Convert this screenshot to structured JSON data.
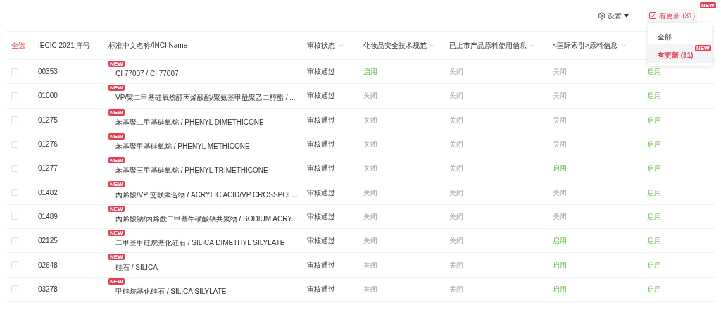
{
  "toolbar": {
    "settings": "设置",
    "update_filter": {
      "label": "有更新 (31)",
      "checked": true,
      "badge": "NEW"
    }
  },
  "dropdown": {
    "items": [
      {
        "label": "全部",
        "selected": false
      },
      {
        "label": "有更新 (31)",
        "selected": true,
        "badge": "NEW"
      }
    ]
  },
  "table": {
    "select_all": "全选",
    "columns": [
      {
        "label": "IECIC 2021 序号",
        "dropdown": false
      },
      {
        "label": "标准中文名称/INCI Name",
        "dropdown": false
      },
      {
        "label": "审核状态",
        "dropdown": true
      },
      {
        "label": "化妆品安全技术规范",
        "dropdown": true
      },
      {
        "label": "已上市产品原料使用信息",
        "dropdown": true
      },
      {
        "label": "<国际索引>原料信息",
        "dropdown": true
      }
    ],
    "rows": [
      {
        "checked": false,
        "id": "00353",
        "badge": "NEW",
        "name": "CI 77007 / CI 77007",
        "status": "审核通过",
        "flags": [
          {
            "text": "启用",
            "on": true
          },
          {
            "text": "关闭",
            "on": false
          },
          {
            "text": "关闭",
            "on": false
          },
          {
            "text": "启用",
            "on": true
          }
        ]
      },
      {
        "checked": false,
        "id": "01000",
        "badge": "NEW",
        "name": "VP/聚二甲基硅氧烷醇丙烯酸酯/聚氨基甲酰聚乙二醇酯 / ...",
        "status": "审核通过",
        "flags": [
          {
            "text": "关闭",
            "on": false
          },
          {
            "text": "关闭",
            "on": false
          },
          {
            "text": "关闭",
            "on": false
          },
          {
            "text": "启用",
            "on": true
          }
        ]
      },
      {
        "checked": false,
        "id": "01275",
        "badge": "NEW",
        "name": "苯基聚二甲基硅氧烷 / PHENYL DIMETHICONE",
        "status": "审核通过",
        "flags": [
          {
            "text": "关闭",
            "on": false
          },
          {
            "text": "关闭",
            "on": false
          },
          {
            "text": "关闭",
            "on": false
          },
          {
            "text": "启用",
            "on": true
          }
        ]
      },
      {
        "checked": false,
        "id": "01276",
        "badge": "NEW",
        "name": "苯基聚甲基硅氧烷 / PHENYL METHICONE",
        "status": "审核通过",
        "flags": [
          {
            "text": "关闭",
            "on": false
          },
          {
            "text": "关闭",
            "on": false
          },
          {
            "text": "关闭",
            "on": false
          },
          {
            "text": "启用",
            "on": true
          }
        ]
      },
      {
        "checked": false,
        "id": "01277",
        "badge": "NEW",
        "name": "苯基聚三甲基硅氧烷 / PHENYL TRIMETHICONE",
        "status": "审核通过",
        "flags": [
          {
            "text": "关闭",
            "on": false
          },
          {
            "text": "关闭",
            "on": false
          },
          {
            "text": "启用",
            "on": true
          },
          {
            "text": "启用",
            "on": true
          }
        ]
      },
      {
        "checked": false,
        "id": "01482",
        "badge": "NEW",
        "name": "丙烯酸/VP 交联聚合物 / ACRYLIC ACID/VP CROSSPOL...",
        "status": "审核通过",
        "flags": [
          {
            "text": "关闭",
            "on": false
          },
          {
            "text": "关闭",
            "on": false
          },
          {
            "text": "关闭",
            "on": false
          },
          {
            "text": "启用",
            "on": true
          }
        ]
      },
      {
        "checked": false,
        "id": "01489",
        "badge": "NEW",
        "name": "丙烯酸钠/丙烯酰二甲基牛磺酸钠共聚物 / SODIUM ACRY...",
        "status": "审核通过",
        "flags": [
          {
            "text": "关闭",
            "on": false
          },
          {
            "text": "关闭",
            "on": false
          },
          {
            "text": "关闭",
            "on": false
          },
          {
            "text": "启用",
            "on": true
          }
        ]
      },
      {
        "checked": false,
        "id": "02125",
        "badge": "NEW",
        "name": "二甲基甲硅烷基化硅石 / SILICA DIMETHYL SILYLATE",
        "status": "审核通过",
        "flags": [
          {
            "text": "关闭",
            "on": false
          },
          {
            "text": "关闭",
            "on": false
          },
          {
            "text": "启用",
            "on": true
          },
          {
            "text": "启用",
            "on": true
          }
        ]
      },
      {
        "checked": false,
        "id": "02648",
        "badge": "NEW",
        "name": "硅石 / SILICA",
        "status": "审核通过",
        "flags": [
          {
            "text": "关闭",
            "on": false
          },
          {
            "text": "关闭",
            "on": false
          },
          {
            "text": "启用",
            "on": true
          },
          {
            "text": "启用",
            "on": true
          }
        ]
      },
      {
        "checked": false,
        "id": "03278",
        "badge": "NEW",
        "name": "甲硅烷基化硅石 / SILICA SILYLATE",
        "status": "审核通过",
        "flags": [
          {
            "text": "关闭",
            "on": false
          },
          {
            "text": "关闭",
            "on": false
          },
          {
            "text": "启用",
            "on": true
          },
          {
            "text": "启用",
            "on": true
          }
        ]
      }
    ]
  }
}
